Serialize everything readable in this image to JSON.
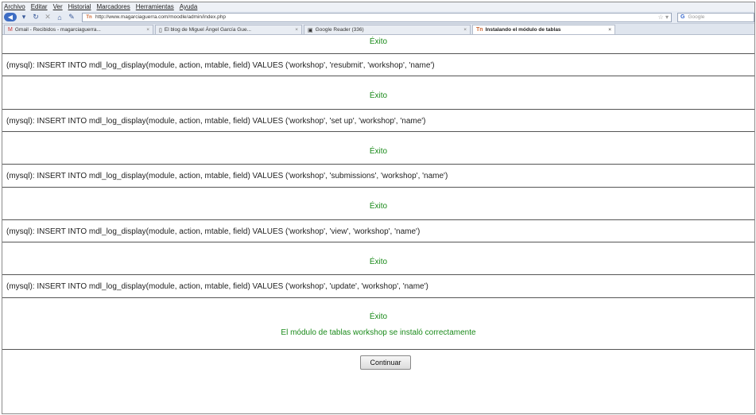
{
  "browser": {
    "menu": [
      "Archivo",
      "Editar",
      "Ver",
      "Historial",
      "Marcadores",
      "Herramientas",
      "Ayuda"
    ],
    "url": "http://www.magarciaguerra.com/moodle/admin/index.php",
    "search_placeholder": "Google",
    "tabs": [
      {
        "label": "Gmail - Recibidos - magarciaguerra...",
        "icon": "gmail-icon"
      },
      {
        "label": "El blog de Miguel Ángel García Gue...",
        "icon": "page-icon"
      },
      {
        "label": "Google Reader (336)",
        "icon": "reader-icon"
      },
      {
        "label": "Instalando el módulo de tablas",
        "icon": "moodle-icon",
        "active": true
      }
    ]
  },
  "page": {
    "success": "Éxito",
    "sql_lines": [
      "(mysql): INSERT INTO mdl_log_display(module, action, mtable, field) VALUES ('workshop', 'resubmit', 'workshop', 'name')",
      "(mysql): INSERT INTO mdl_log_display(module, action, mtable, field) VALUES ('workshop', 'set up', 'workshop', 'name')",
      "(mysql): INSERT INTO mdl_log_display(module, action, mtable, field) VALUES ('workshop', 'submissions', 'workshop', 'name')",
      "(mysql): INSERT INTO mdl_log_display(module, action, mtable, field) VALUES ('workshop', 'view', 'workshop', 'name')",
      "(mysql): INSERT INTO mdl_log_display(module, action, mtable, field) VALUES ('workshop', 'update', 'workshop', 'name')"
    ],
    "final_message": "El módulo de tablas workshop se instaló correctamente",
    "continue_label": "Continuar"
  },
  "colors": {
    "success_green": "#1a8a1a",
    "rule": "#555555"
  }
}
